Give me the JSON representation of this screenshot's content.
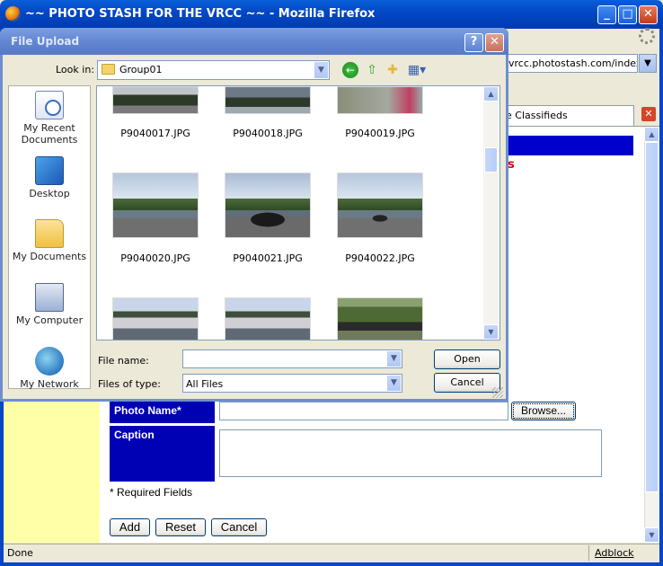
{
  "browser": {
    "title": "~~ PHOTO STASH FOR THE VRCC ~~ - Mozilla Firefox",
    "address": "vrcc.photostash.com/index.php",
    "tab_label": "e Classifieds",
    "status_text": "Done",
    "adblock_label": "Adblock",
    "page_partial_text": "s"
  },
  "form": {
    "photo_name_label": "Photo Name*",
    "caption_label": "Caption",
    "browse_label": "Browse...",
    "required_note": "* Required Fields",
    "add_label": "Add",
    "reset_label": "Reset",
    "cancel_label": "Cancel"
  },
  "dialog": {
    "title": "File Upload",
    "help_glyph": "?",
    "close_glyph": "✕",
    "look_in_label": "Look in:",
    "look_in_value": "Group01",
    "places": [
      {
        "label": "My Recent Documents",
        "icon": "recent-documents-icon"
      },
      {
        "label": "Desktop",
        "icon": "desktop-icon"
      },
      {
        "label": "My Documents",
        "icon": "my-documents-icon"
      },
      {
        "label": "My Computer",
        "icon": "my-computer-icon"
      },
      {
        "label": "My Network",
        "icon": "my-network-icon"
      }
    ],
    "files": [
      {
        "name": "P9040017.JPG"
      },
      {
        "name": "P9040018.JPG"
      },
      {
        "name": "P9040019.JPG"
      },
      {
        "name": "P9040020.JPG"
      },
      {
        "name": "P9040021.JPG"
      },
      {
        "name": "P9040022.JPG"
      }
    ],
    "file_name_label": "File name:",
    "file_name_value": "",
    "files_of_type_label": "Files of type:",
    "files_of_type_value": "All Files",
    "open_label": "Open",
    "cancel_label": "Cancel"
  },
  "colors": {
    "titlebar_blue": "#0348c6",
    "form_label_blue": "#0000b4",
    "accent_red": "#e00000",
    "page_yellow": "#ffffa8"
  }
}
